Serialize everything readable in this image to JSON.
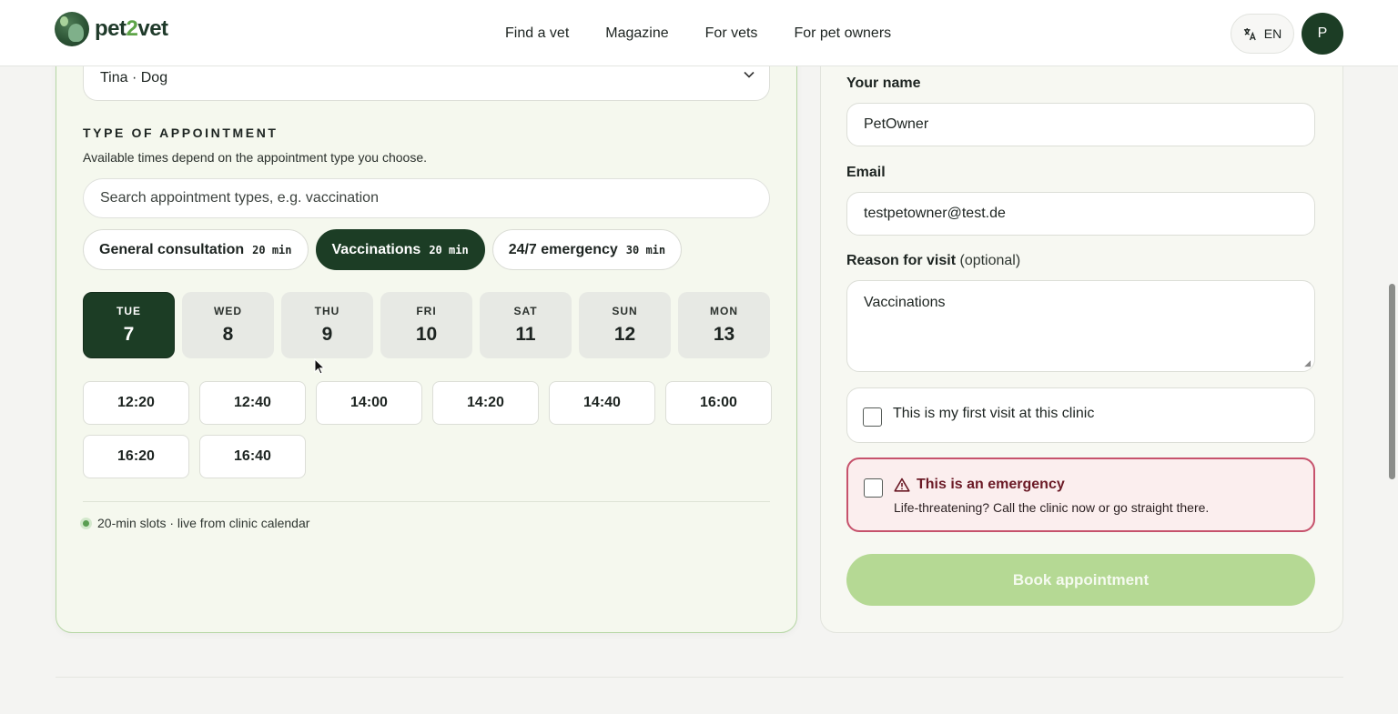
{
  "header": {
    "logo_text_prefix": "pet",
    "logo_text_accent": "2",
    "logo_text_suffix": "vet",
    "nav": [
      "Find a vet",
      "Magazine",
      "For vets",
      "For pet owners"
    ],
    "language": "EN",
    "avatar_initial": "P"
  },
  "booking": {
    "pet_selected": "Tina · Dog",
    "section_title": "TYPE OF APPOINTMENT",
    "section_desc": "Available times depend on the appointment type you choose.",
    "search_placeholder": "Search appointment types, e.g. vaccination",
    "types": [
      {
        "label": "General consultation",
        "duration": "20 min",
        "selected": false
      },
      {
        "label": "Vaccinations",
        "duration": "20 min",
        "selected": true
      },
      {
        "label": "24/7 emergency",
        "duration": "30 min",
        "selected": false
      }
    ],
    "days": [
      {
        "dow": "TUE",
        "num": "7",
        "selected": true
      },
      {
        "dow": "WED",
        "num": "8",
        "selected": false
      },
      {
        "dow": "THU",
        "num": "9",
        "selected": false
      },
      {
        "dow": "FRI",
        "num": "10",
        "selected": false
      },
      {
        "dow": "SAT",
        "num": "11",
        "selected": false
      },
      {
        "dow": "SUN",
        "num": "12",
        "selected": false
      },
      {
        "dow": "MON",
        "num": "13",
        "selected": false
      }
    ],
    "slots": [
      "12:20",
      "12:40",
      "14:00",
      "14:20",
      "14:40",
      "16:00",
      "16:20",
      "16:40"
    ],
    "live_note": "20-min slots · live from clinic calendar"
  },
  "form": {
    "name_label": "Your name",
    "name_value": "PetOwner",
    "email_label": "Email",
    "email_value": "testpetowner@test.de",
    "reason_label": "Reason for visit",
    "reason_optional": "(optional)",
    "reason_value": "Vaccinations",
    "first_visit_label": "This is my first visit at this clinic",
    "emergency_title": "This is an emergency",
    "emergency_desc": "Life-threatening? Call the clinic now or go straight there.",
    "book_button": "Book appointment"
  },
  "colors": {
    "brand_dark": "#1c3d25",
    "brand_accent": "#5ea448",
    "book_disabled": "#b5d994",
    "emergency_border": "#c6526c"
  }
}
